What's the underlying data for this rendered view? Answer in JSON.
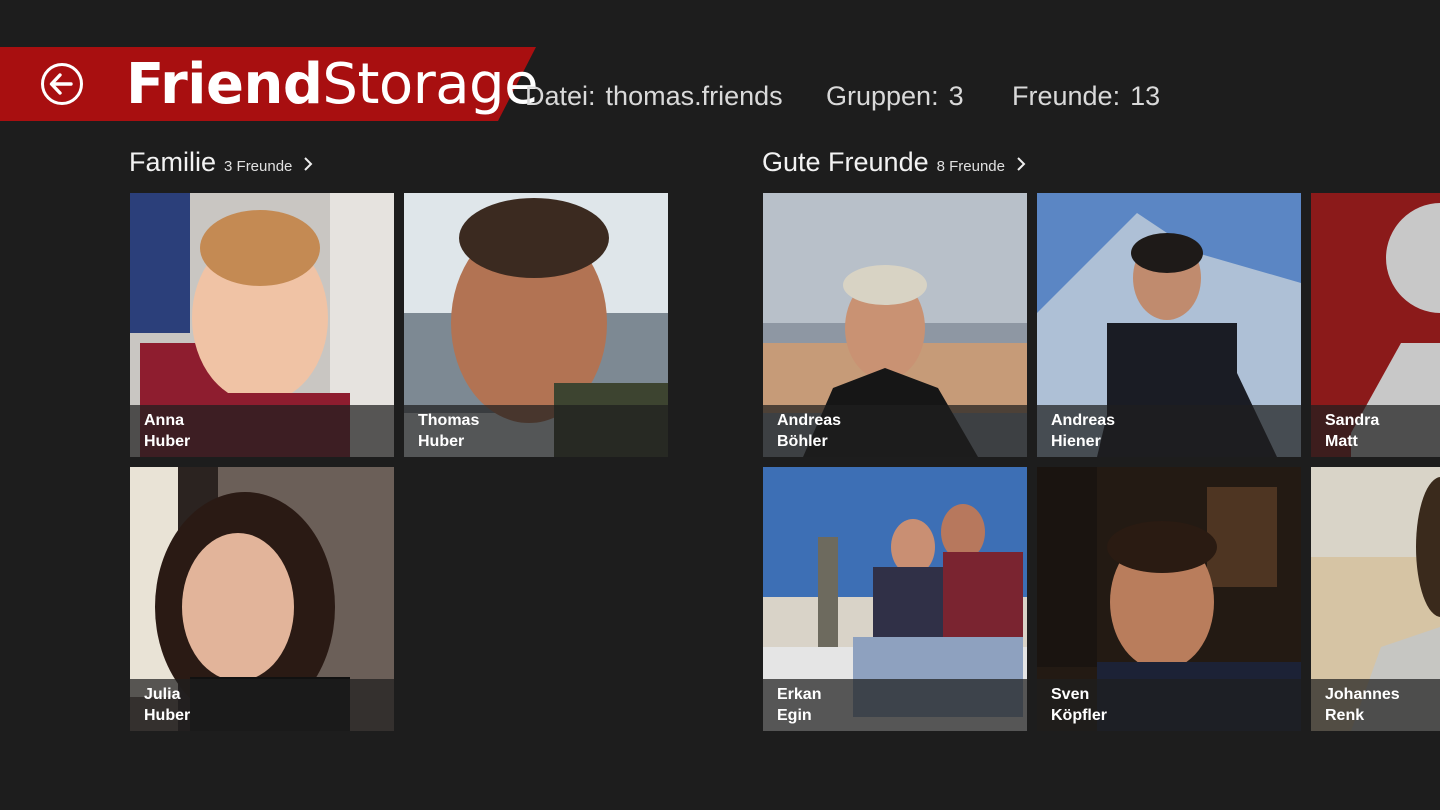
{
  "app": {
    "title_bold": "Friend",
    "title_light": "Storage",
    "accent": "#a80f10"
  },
  "stats": {
    "file_label": "Datei:",
    "file_value": "thomas.friends",
    "groups_label": "Gruppen:",
    "groups_value": "3",
    "friends_label": "Freunde:",
    "friends_value": "13"
  },
  "groups": [
    {
      "title": "Familie",
      "count": "3 Freunde",
      "friends": [
        {
          "first": "Anna",
          "last": "Huber"
        },
        {
          "first": "Thomas",
          "last": "Huber"
        },
        {
          "first": "Julia",
          "last": "Huber"
        }
      ]
    },
    {
      "title": "Gute Freunde",
      "count": "8 Freunde",
      "friends": [
        {
          "first": "Andreas",
          "last": "Böhler"
        },
        {
          "first": "Andreas",
          "last": "Hiener"
        },
        {
          "first": "Sandra",
          "last": "Matt"
        },
        {
          "first": "Erkan",
          "last": "Egin"
        },
        {
          "first": "Sven",
          "last": "Köpfler"
        },
        {
          "first": "Johannes",
          "last": "Renk"
        }
      ]
    }
  ],
  "icons": {
    "back": "back-arrow-icon",
    "chevron": "chevron-right-icon",
    "placeholder": "person-placeholder-icon"
  }
}
